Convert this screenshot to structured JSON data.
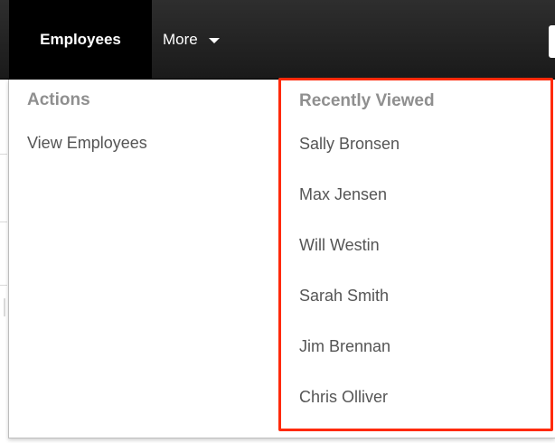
{
  "nav": {
    "active_tab": "Employees",
    "more_label": "More"
  },
  "dropdown": {
    "actions": {
      "heading": "Actions",
      "items": [
        "View Employees"
      ]
    },
    "recently_viewed": {
      "heading": "Recently Viewed",
      "items": [
        "Sally Bronsen",
        "Max Jensen",
        "Will Westin",
        "Sarah Smith",
        "Jim Brennan",
        "Chris Olliver"
      ]
    }
  },
  "colors": {
    "highlight_border": "#ff2a0a",
    "nav_background": "#1f1f1f",
    "heading_text": "#8f8f8f",
    "item_text": "#555555"
  }
}
